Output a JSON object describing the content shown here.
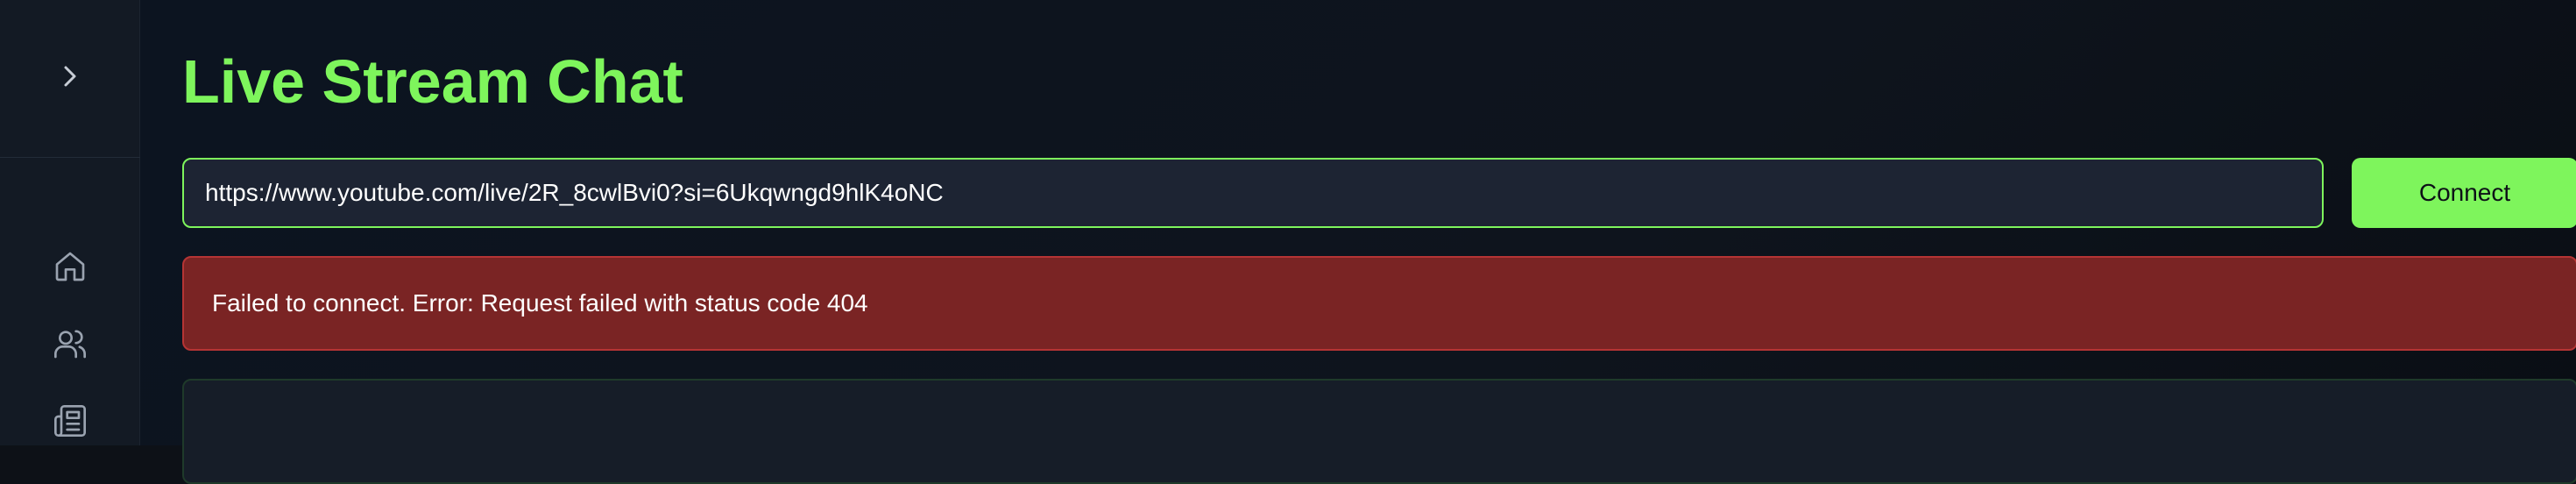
{
  "sidebar": {
    "toggle_icon": "chevron-right-icon",
    "items": [
      {
        "name": "home",
        "icon": "home-icon"
      },
      {
        "name": "users",
        "icon": "users-icon"
      },
      {
        "name": "news",
        "icon": "newspaper-icon"
      }
    ]
  },
  "main": {
    "title": "Live Stream Chat",
    "url_input": {
      "value": "https://www.youtube.com/live/2R_8cwlBvi0?si=6Ukqwngd9hlK4oNC"
    },
    "connect_label": "Connect",
    "error_message": "Failed to connect. Error: Request failed with status code 404"
  },
  "colors": {
    "accent": "#7ef55c",
    "error_bg": "#7a2424",
    "error_border": "#b53434",
    "background": "#0d1117",
    "sidebar_bg": "#131a24",
    "input_bg": "#1d2433"
  }
}
